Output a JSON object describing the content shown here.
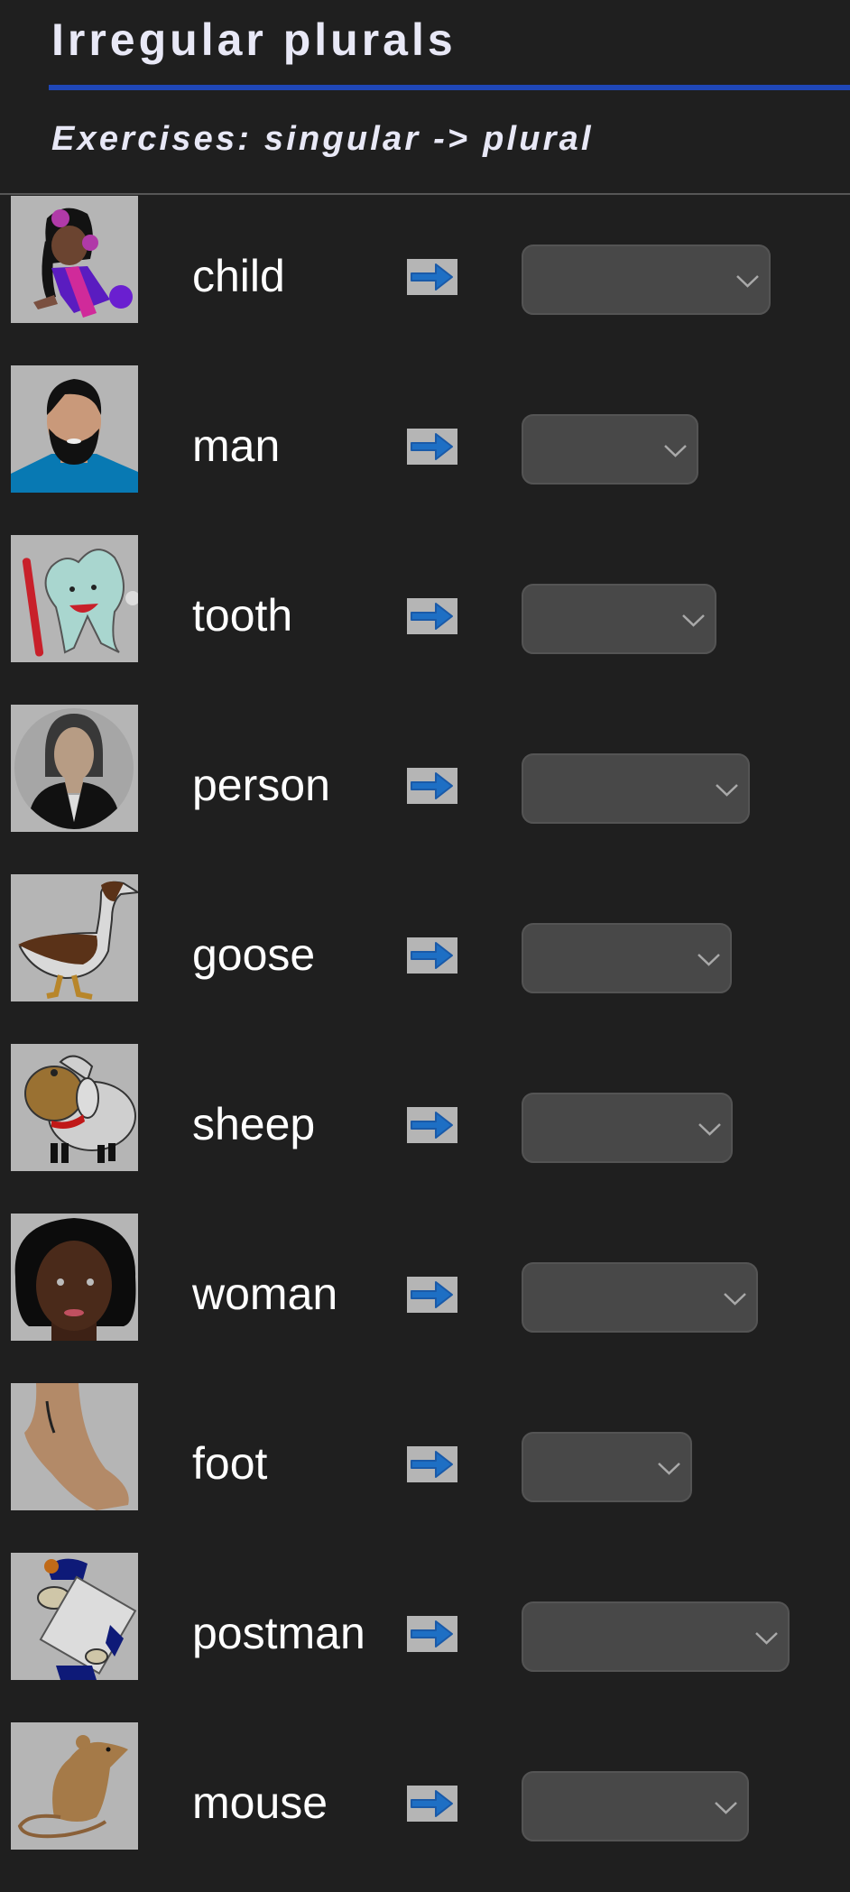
{
  "header": {
    "title": "Irregular plurals",
    "subtitle": "Exercises: singular -> plural"
  },
  "colors": {
    "background": "#1f1f1f",
    "title_text": "#e8e8f6",
    "accent_rule": "#1f47b8",
    "select_bg": "#484848",
    "arrow_blue": "#1e6fc4"
  },
  "exercises": [
    {
      "word": "child",
      "image": "girl-child-illustration",
      "answer": ""
    },
    {
      "word": "man",
      "image": "bearded-man-illustration",
      "answer": ""
    },
    {
      "word": "tooth",
      "image": "tooth-with-toothbrush-illustration",
      "answer": ""
    },
    {
      "word": "person",
      "image": "person-avatar-illustration",
      "answer": ""
    },
    {
      "word": "goose",
      "image": "goose-illustration",
      "answer": ""
    },
    {
      "word": "sheep",
      "image": "sheep-illustration",
      "answer": ""
    },
    {
      "word": "woman",
      "image": "woman-face-illustration",
      "answer": ""
    },
    {
      "word": "foot",
      "image": "foot-illustration",
      "answer": ""
    },
    {
      "word": "postman",
      "image": "postman-illustration",
      "answer": ""
    },
    {
      "word": "mouse",
      "image": "mouse-illustration",
      "answer": ""
    }
  ],
  "arrow_icon": "right-arrow-icon",
  "dropdown_icon": "chevron-down-icon"
}
